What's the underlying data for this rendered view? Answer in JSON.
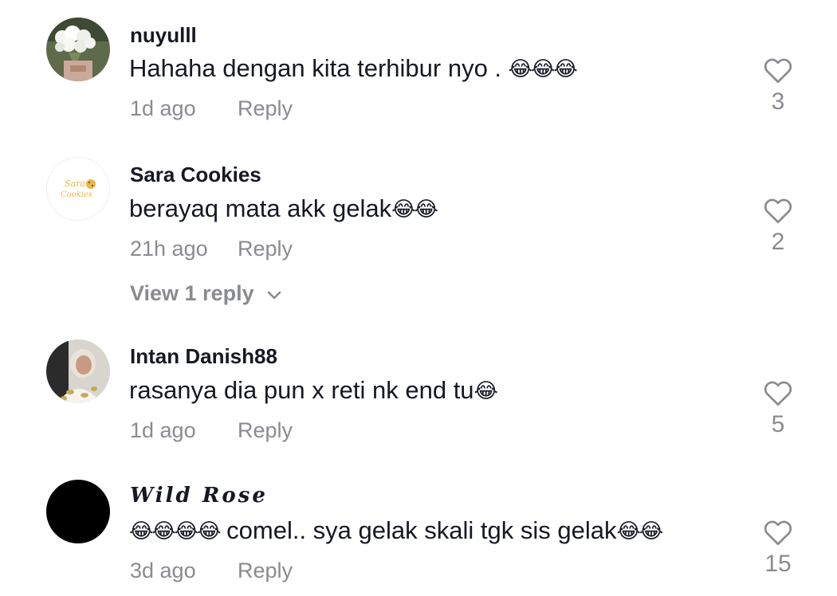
{
  "comments": [
    {
      "username": "nuyulll",
      "text": "Hahaha dengan kita terhibur nyo . ",
      "emoji_after": "😂😂😂",
      "time": "1d ago",
      "reply_label": "Reply",
      "likes": "3"
    },
    {
      "username": "Sara Cookies",
      "avatar_text": "Sara Cookies",
      "text": "berayaq mata akk gelak",
      "emoji_after": "😂😂",
      "time": "21h ago",
      "reply_label": "Reply",
      "likes": "2",
      "view_replies": "View 1 reply"
    },
    {
      "username": "Intan Danish88",
      "text": "rasanya dia pun x reti nk end tu",
      "emoji_after": "😂",
      "time": "1d ago",
      "reply_label": "Reply",
      "likes": "5"
    },
    {
      "username": "Wild Rose",
      "emoji_before": "😂😂😂😂",
      "text": " comel.. sya gelak skali tgk sis gelak",
      "emoji_after": "😂😂",
      "time": "3d ago",
      "reply_label": "Reply",
      "likes": "15"
    }
  ],
  "colors": {
    "text": "#161823",
    "secondary": "#8a8b91",
    "avatar_black": "#000000",
    "sara_logo": "#e9b64a"
  },
  "icons": {
    "like": "heart-outline-icon",
    "expand": "chevron-down-icon"
  }
}
